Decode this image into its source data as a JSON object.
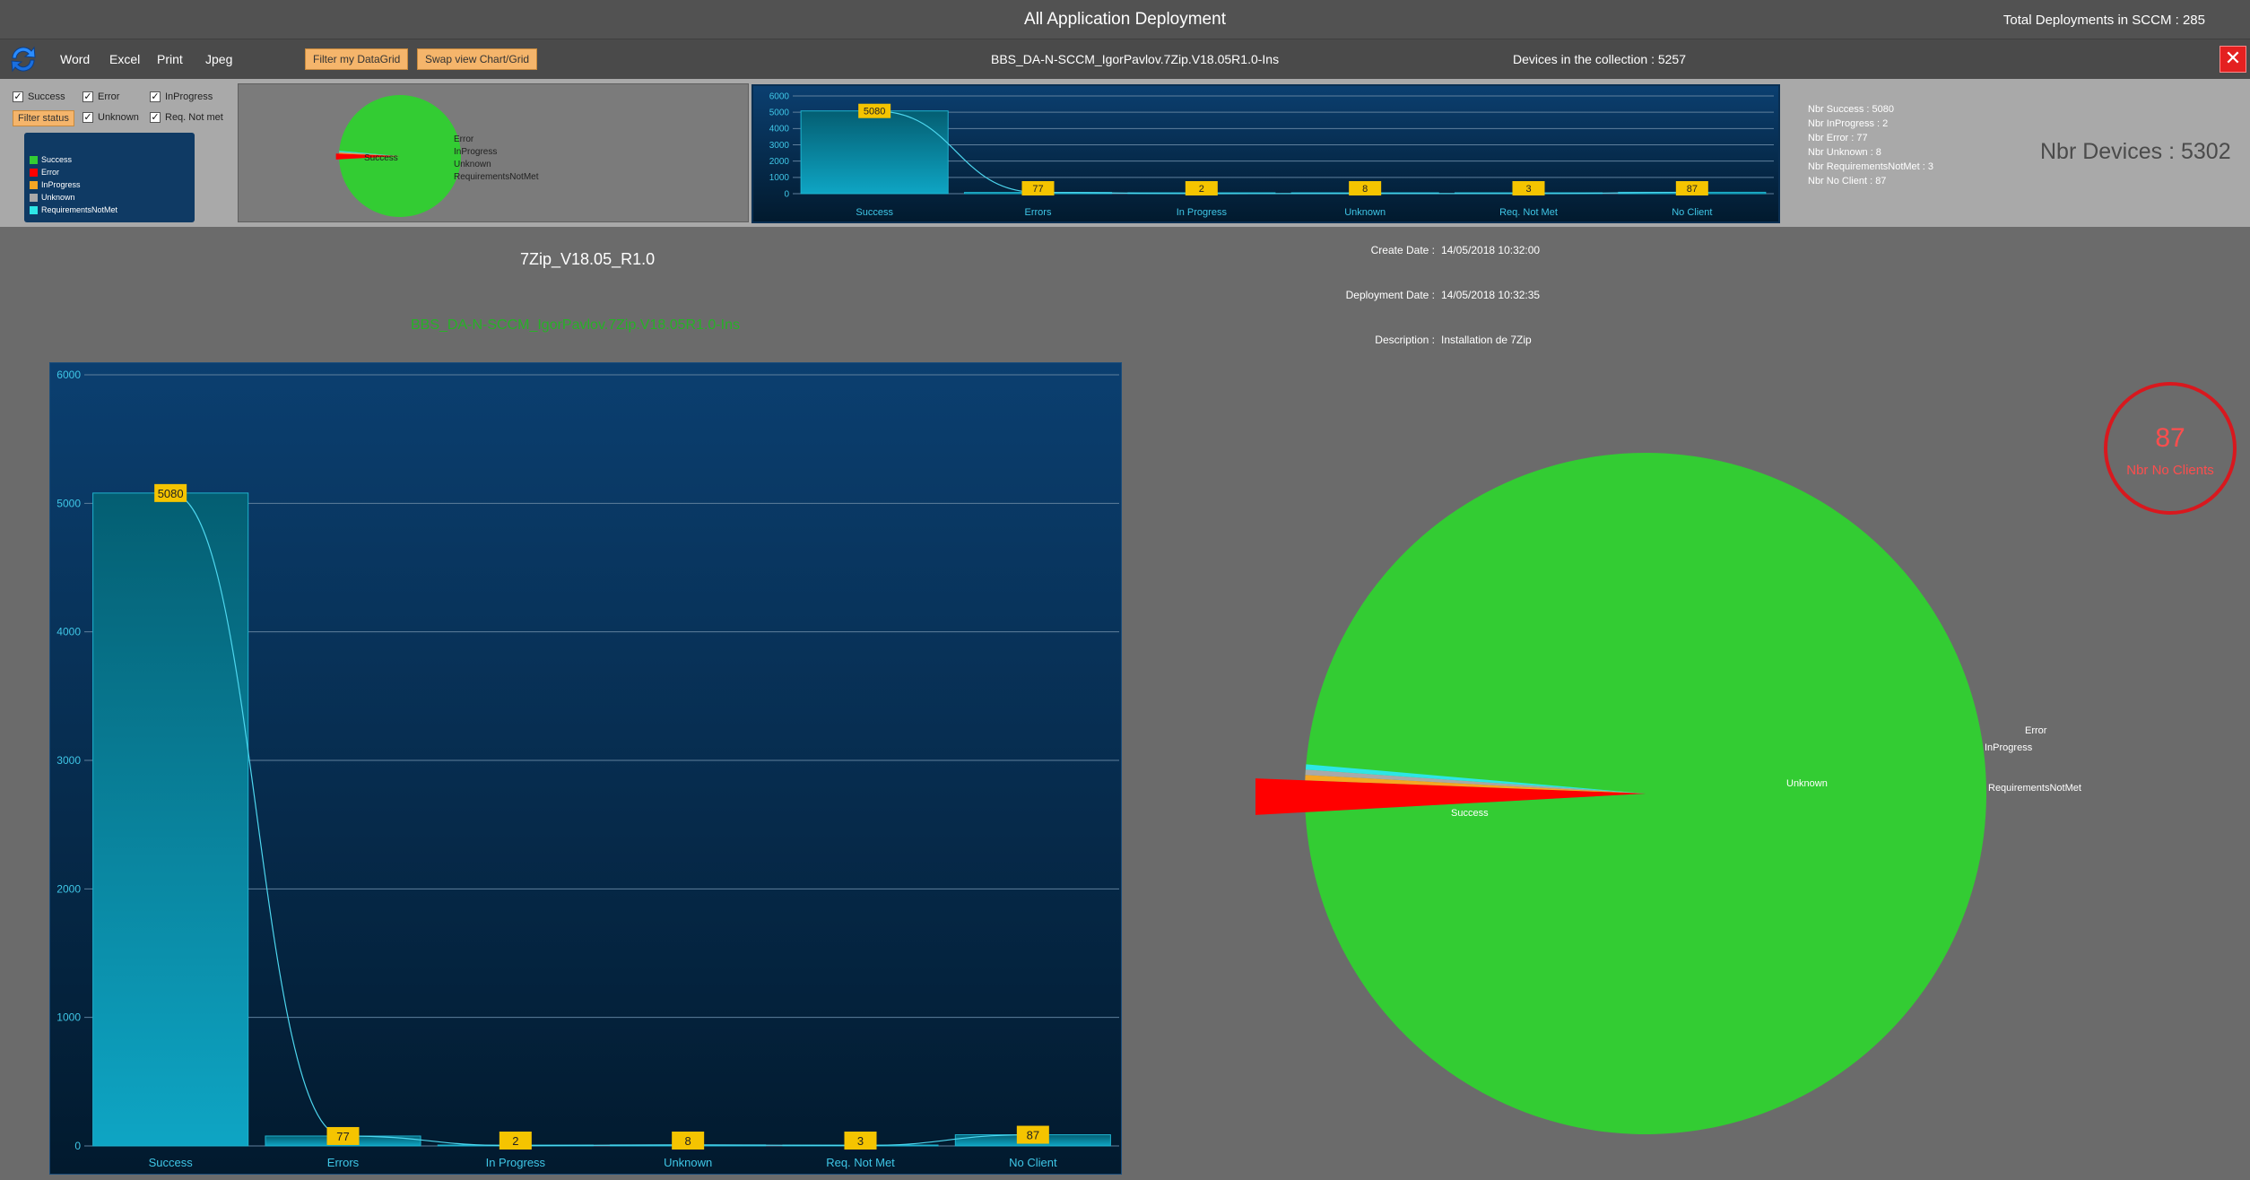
{
  "header": {
    "title": "All Application Deployment",
    "total_deployments": "Total Deployments in SCCM : 285"
  },
  "toolbar": {
    "refresh_icon": "refresh-icon",
    "menu": [
      "Word",
      "Excel",
      "Print",
      "Jpeg"
    ],
    "filter_datagrid_label": "Filter my DataGrid",
    "swap_view_label": "Swap view Chart/Grid",
    "deployment_name": "BBS_DA-N-SCCM_IgorPavlov.7Zip.V18.05R1.0-Ins",
    "devices_in_collection": "Devices in the collection : 5257",
    "close_label": "✕"
  },
  "filters": {
    "checkboxes": [
      {
        "label": "Success",
        "checked": true
      },
      {
        "label": "Error",
        "checked": true
      },
      {
        "label": "InProgress",
        "checked": true
      },
      {
        "label": "Unknown",
        "checked": true
      },
      {
        "label": "Req. Not met",
        "checked": true
      }
    ],
    "filter_status_label": "Filter status"
  },
  "legend": [
    {
      "label": "Success",
      "color": "#33cc33"
    },
    {
      "label": "Error",
      "color": "#ff0000"
    },
    {
      "label": "InProgress",
      "color": "#f5a623"
    },
    {
      "label": "Unknown",
      "color": "#a9a9a9"
    },
    {
      "label": "RequirementsNotMet",
      "color": "#2ee6e6"
    }
  ],
  "stats": {
    "success": "Nbr Success : 5080",
    "inprogress": "Nbr InProgress : 2",
    "error": "Nbr Error : 77",
    "unknown": "Nbr Unknown : 8",
    "reqnotmet": "Nbr RequirementsNotMet : 3",
    "noclient": "Nbr No Client : 87",
    "nbr_devices": "Nbr Devices : 5302"
  },
  "details": {
    "app_title": "7Zip_V18.05_R1.0",
    "deployment_subtitle": "BBS_DA-N-SCCM_IgorPavlov.7Zip.V18.05R1.0-Ins",
    "create_date_label": "Create Date :",
    "create_date": "14/05/2018 10:32:00",
    "deployment_date_label": "Deployment Date :",
    "deployment_date": "14/05/2018 10:32:35",
    "description_label": "Description :",
    "description": "Installation de 7Zip"
  },
  "no_clients": {
    "value": "87",
    "label": "Nbr No Clients"
  },
  "colors": {
    "success": "#33cc33",
    "error": "#ff0000",
    "unknown": "#a9a9a9",
    "reqnotmet": "#2ee6e6",
    "label_bg": "#f5c400",
    "bar": "#0ea5c4"
  },
  "chart_data": [
    {
      "type": "bar",
      "categories": [
        "Success",
        "Errors",
        "In Progress",
        "Unknown",
        "Req. Not Met",
        "No Client"
      ],
      "values": [
        5080,
        77,
        2,
        8,
        3,
        87
      ],
      "yticks": [
        0,
        1000,
        2000,
        3000,
        4000,
        5000,
        6000
      ],
      "ylim": [
        0,
        6000
      ],
      "grid": true
    },
    {
      "type": "bar",
      "categories": [
        "Success",
        "Errors",
        "In Progress",
        "Unknown",
        "Req. Not Met",
        "No Client"
      ],
      "values": [
        5080,
        77,
        2,
        8,
        3,
        87
      ],
      "yticks": [
        0,
        1000,
        2000,
        3000,
        4000,
        5000,
        6000
      ],
      "ylim": [
        0,
        6000
      ],
      "grid": true
    },
    {
      "type": "pie",
      "slices": [
        {
          "label": "Success",
          "value": 5080
        },
        {
          "label": "Error",
          "value": 77
        },
        {
          "label": "InProgress",
          "value": 2
        },
        {
          "label": "Unknown",
          "value": 8
        },
        {
          "label": "RequirementsNotMet",
          "value": 3
        }
      ]
    },
    {
      "type": "pie",
      "slices": [
        {
          "label": "Success",
          "value": 5080
        },
        {
          "label": "Error",
          "value": 77
        },
        {
          "label": "InProgress",
          "value": 2
        },
        {
          "label": "Unknown",
          "value": 8
        },
        {
          "label": "RequirementsNotMet",
          "value": 3
        }
      ]
    }
  ]
}
